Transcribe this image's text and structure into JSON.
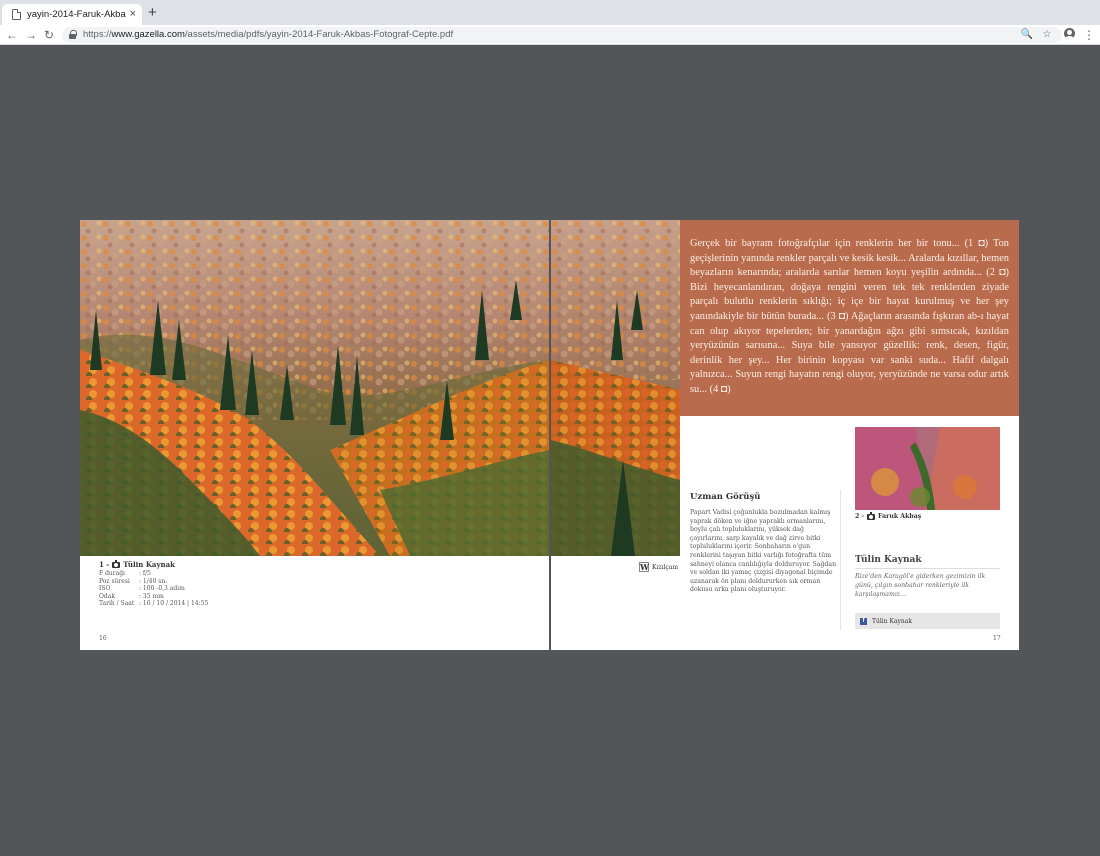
{
  "browser": {
    "tab_title": "yayin-2014-Faruk-Akbas-Fotog",
    "tab_close": "×",
    "new_tab": "+",
    "url_scheme": "https://",
    "url_host": "www.gazella.com",
    "url_path": "/assets/media/pdfs/yayin-2014-Faruk-Akbas-Fotograf-Cepte.pdf",
    "back": "←",
    "forward": "→",
    "reload": "↻",
    "search": "🔍",
    "star": "☆",
    "menu": "⋮"
  },
  "left_page": {
    "caption_number": "1 -",
    "caption_author": "Tülin Kaynak",
    "exif": [
      {
        "label": "F durağı",
        "value": ": f/5"
      },
      {
        "label": "Poz süresi",
        "value": ": 1/40 sn."
      },
      {
        "label": "ISO",
        "value": ": 100 -0,3 adım"
      },
      {
        "label": "Odak",
        "value": ": 35 mm"
      },
      {
        "label": "Tarih / Saat",
        "value": ": 16 / 10 / 2014 | 14:55"
      }
    ],
    "page_number": "16"
  },
  "right_page": {
    "wiki_glyph": "W",
    "wiki_label": "Kızılçam",
    "quote": "Gerçek bir bayram fotoğrafçılar için renklerin her bir tonu... (1 ◘) Ton geçişlerinin yanında renkler parçalı ve kesik kesik... Aralarda kızıllar, hemen beyazların kenarında; aralarda sarılar hemen koyu yeşilin ardında... (2 ◘) Bizi heyecanlandıran, doğaya rengini veren tek tek renklerden ziyade parçalı bulutlu renklerin sıklığı; iç içe bir hayat kurulmuş ve her şey yanındakiyle bir bütün burada... (3 ◘) Ağaçların arasında fışkıran ab-ı hayat can olup akıyor tepelerden; bir yanardağın ağzı gibi sımsıcak, kızıldan yeryüzünün sarısına... Suya bile yansıyor güzellik: renk, desen, figür, derinlik her şey... Her birinin kopyası var sanki suda... Hafif dalgalı yalnızca... Suyun rengi hayatın rengi oluyor, yeryüzünde ne varsa odur artık su... (4 ◘)",
    "expert_title": "Uzman Görüşü",
    "expert_body": "Papart Vadisi çoğunlukla bozulmadan kalmış yaprak döken ve iğne yapraklı ormanlarını, boylu çalı topluluklarını, yüksek dağ çayırlarını, sarp kayalık ve dağ zirve bitki topluluklarını içerir. Sonbaharın o'gun renklerini taşıyan bitki varlığı fotoğrafta tüm sahneyi olanca canlılığıyla dolduruyor. Sağdan ve soldan iki yamaç çizgisi diyagonal biçimde uzanarak ön planı doldururken sık orman dokusu arka planı oluşturuyor.",
    "thumb_caption_number": "2 -",
    "thumb_caption_author": "Faruk Akbaş",
    "author_name": "Tülin Kaynak",
    "author_bio": "Rize'den Karagöl'e giderken gezimizin ilk günü, çılgın sonbahar renkleriyle ilk karşılaşmamız...",
    "fb_glyph": "f",
    "fb_label": "Tülin Kaynak",
    "page_number": "17"
  },
  "colors": {
    "viewer_bg": "#525659",
    "quote_bg": "#b96c4d",
    "quote_text": "#fbeee6"
  }
}
